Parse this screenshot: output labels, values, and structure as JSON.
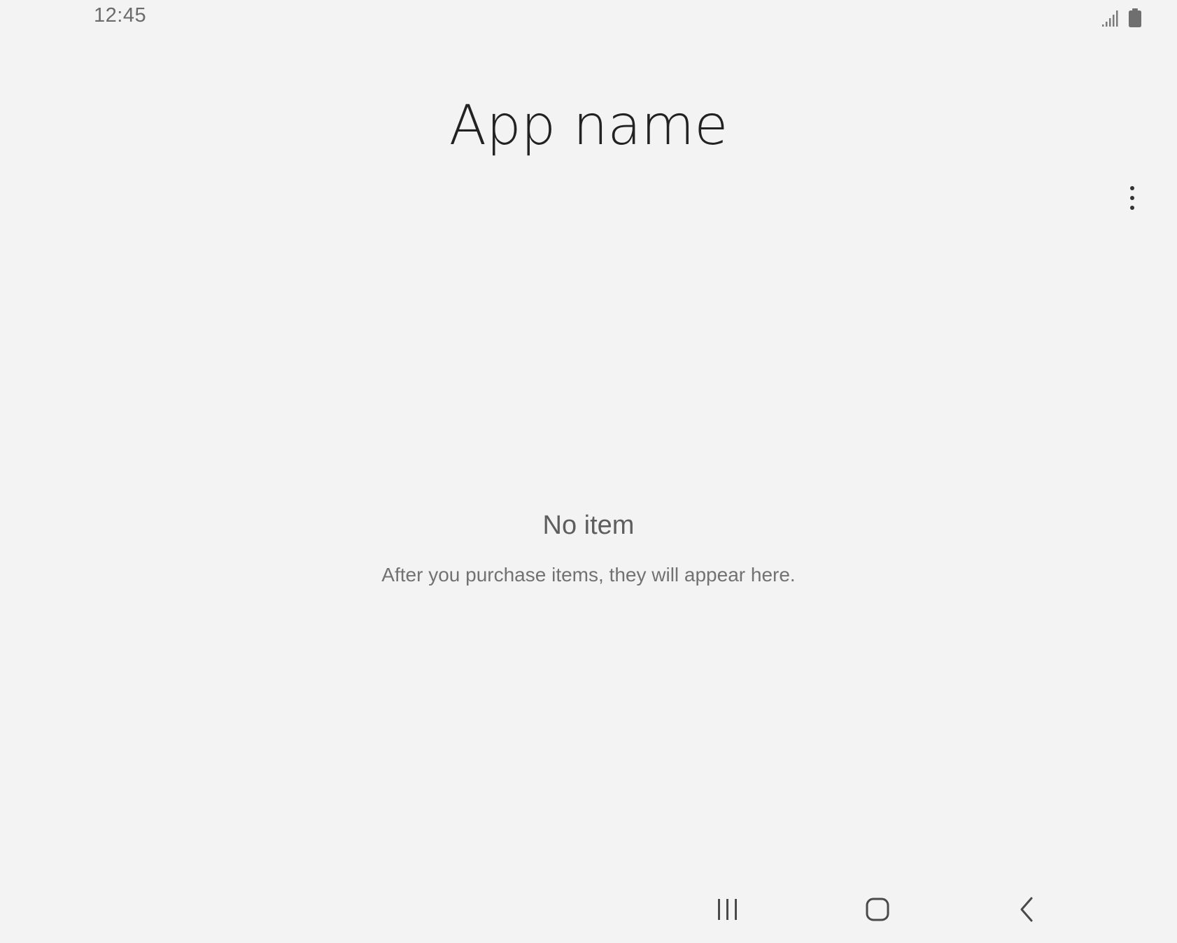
{
  "status_bar": {
    "time": "12:45",
    "icons": [
      "signal-icon",
      "battery-icon"
    ]
  },
  "header": {
    "title": "App name",
    "more_icon": "more-vertical-icon"
  },
  "empty_state": {
    "title": "No item",
    "description": "After you purchase items, they will appear here."
  },
  "nav_bar": {
    "icons": [
      "recents-icon",
      "home-icon",
      "back-icon"
    ]
  },
  "colors": {
    "background": "#f3f3f3",
    "title_text": "#222222",
    "secondary_text": "#727272"
  }
}
